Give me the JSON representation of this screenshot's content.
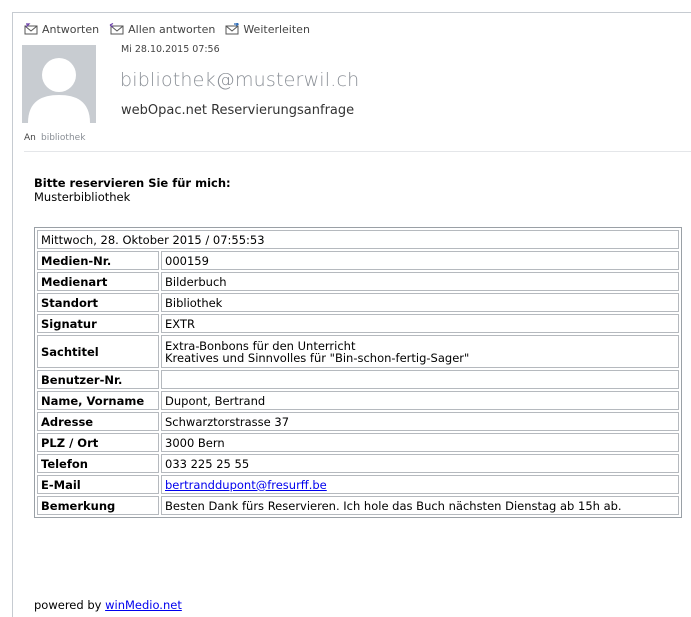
{
  "toolbar": {
    "reply": "Antworten",
    "reply_all": "Allen antworten",
    "forward": "Weiterleiten"
  },
  "message": {
    "date": "Mi 28.10.2015 07:56",
    "sender": "bibliothek@musterwil.ch",
    "subject": "webOpac.net Reservierungsanfrage",
    "to_label": "An",
    "to_value": "bibliothek"
  },
  "body": {
    "heading": "Bitte reservieren Sie für mich:",
    "library": "Musterbibliothek"
  },
  "table": {
    "header": "Mittwoch, 28. Oktober 2015 / 07:55:53",
    "rows": [
      {
        "key": "Medien-Nr.",
        "value": "000159"
      },
      {
        "key": "Medienart",
        "value": "Bilderbuch"
      },
      {
        "key": "Standort",
        "value": "Bibliothek"
      },
      {
        "key": "Signatur",
        "value": "EXTR"
      },
      {
        "key": "Sachtitel",
        "value": "Extra-Bonbons für den Unterricht",
        "value2": "Kreatives und Sinnvolles für \"Bin-schon-fertig-Sager\""
      },
      {
        "key": "Benutzer-Nr.",
        "value": ""
      },
      {
        "key": "Name, Vorname",
        "value": "Dupont, Bertrand"
      },
      {
        "key": "Adresse",
        "value": "Schwarztorstrasse 37"
      },
      {
        "key": "PLZ / Ort",
        "value": "3000 Bern"
      },
      {
        "key": "Telefon",
        "value": "033 225 25 55"
      },
      {
        "key": "E-Mail",
        "value": "bertranddupont@fresurff.be"
      },
      {
        "key": "Bemerkung",
        "value": "Besten Dank fürs Reservieren. Ich hole das Buch nächsten Dienstag ab 15h ab."
      }
    ]
  },
  "footer": {
    "prefix": "powered by ",
    "link": "winMedio.net"
  }
}
